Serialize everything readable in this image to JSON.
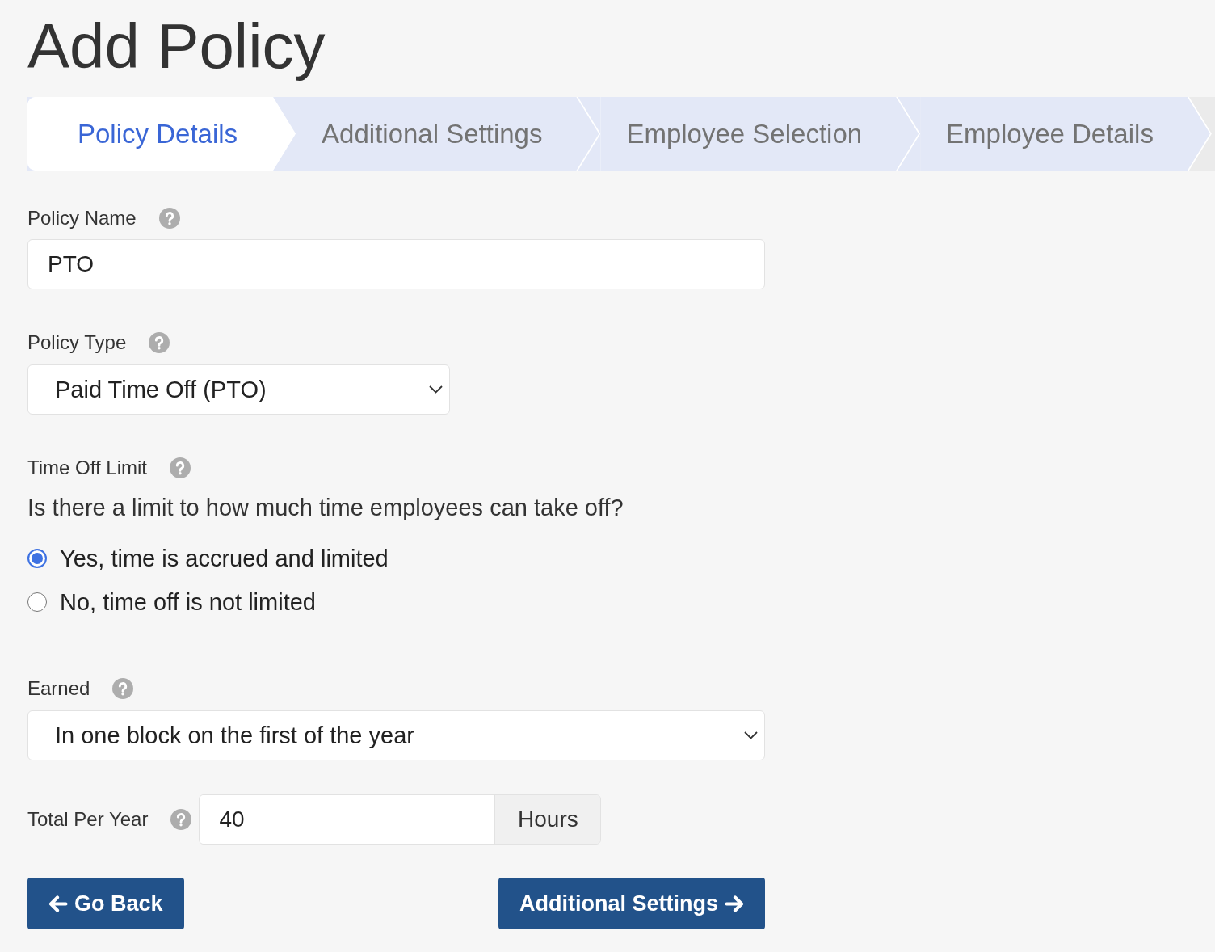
{
  "title": "Add Policy",
  "steps": [
    {
      "label": "Policy Details",
      "selected": true
    },
    {
      "label": "Additional Settings",
      "selected": false
    },
    {
      "label": "Employee Selection",
      "selected": false
    },
    {
      "label": "Employee Details",
      "selected": false
    }
  ],
  "policy_name": {
    "label": "Policy Name",
    "value": "PTO"
  },
  "policy_type": {
    "label": "Policy Type",
    "value": "Paid Time Off (PTO)"
  },
  "time_off_limit": {
    "label": "Time Off Limit",
    "question": "Is there a limit to how much time employees can take off?",
    "options": [
      {
        "label": "Yes, time is accrued and limited",
        "selected": true
      },
      {
        "label": "No, time off is not limited",
        "selected": false
      }
    ]
  },
  "earned": {
    "label": "Earned",
    "value": "In one block on the first of the year"
  },
  "total_per_year": {
    "label": "Total Per Year",
    "value": "40",
    "unit": "Hours"
  },
  "buttons": [
    {
      "label": "Go Back",
      "kind": "back"
    },
    {
      "label": "Additional Settings",
      "kind": "next"
    }
  ]
}
